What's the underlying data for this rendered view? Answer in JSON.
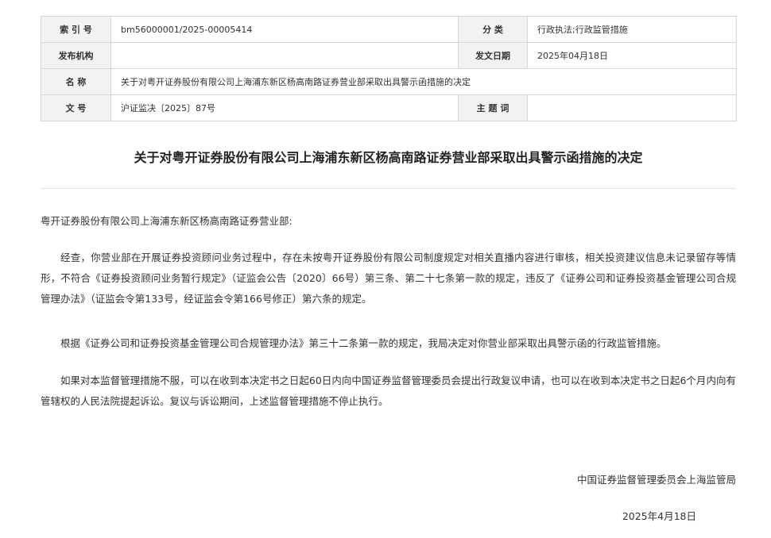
{
  "meta": {
    "index_label": "索 引 号",
    "index_value": "bm56000001/2025-00005414",
    "category_label": "分 类",
    "category_value": "行政执法;行政监管措施",
    "publisher_label": "发布机构",
    "publisher_value": "",
    "date_label": "发文日期",
    "date_value": "2025年04月18日",
    "name_label": "名 称",
    "name_value": "关于对粤开证券股份有限公司上海浦东新区杨高南路证券营业部采取出具警示函措施的决定",
    "docno_label": "文 号",
    "docno_value": "沪证监决〔2025〕87号",
    "subject_label": "主 题 词",
    "subject_value": ""
  },
  "document": {
    "title": "关于对粤开证券股份有限公司上海浦东新区杨高南路证券营业部采取出具警示函措施的决定",
    "addressee": "粤开证券股份有限公司上海浦东新区杨高南路证券营业部:",
    "paragraphs": [
      "经查，你营业部在开展证券投资顾问业务过程中，存在未按粤开证券股份有限公司制度规定对相关直播内容进行审核，相关投资建议信息未记录留存等情形，不符合《证券投资顾问业务暂行规定》（证监会公告〔2020〕66号）第三条、第二十七条第一款的规定，违反了《证券公司和证券投资基金管理公司合规管理办法》（证监会令第133号，经证监会令第166号修正）第六条的规定。",
      "根据《证券公司和证券投资基金管理公司合规管理办法》第三十二条第一款的规定，我局决定对你营业部采取出具警示函的行政监管措施。",
      "如果对本监督管理措施不服，可以在收到本决定书之日起60日内向中国证券监督管理委员会提出行政复议申请，也可以在收到本决定书之日起6个月内向有管辖权的人民法院提起诉讼。复议与诉讼期间，上述监督管理措施不停止执行。"
    ],
    "signature": "中国证券监督管理委员会上海监管局",
    "sign_date": "2025年4月18日"
  }
}
